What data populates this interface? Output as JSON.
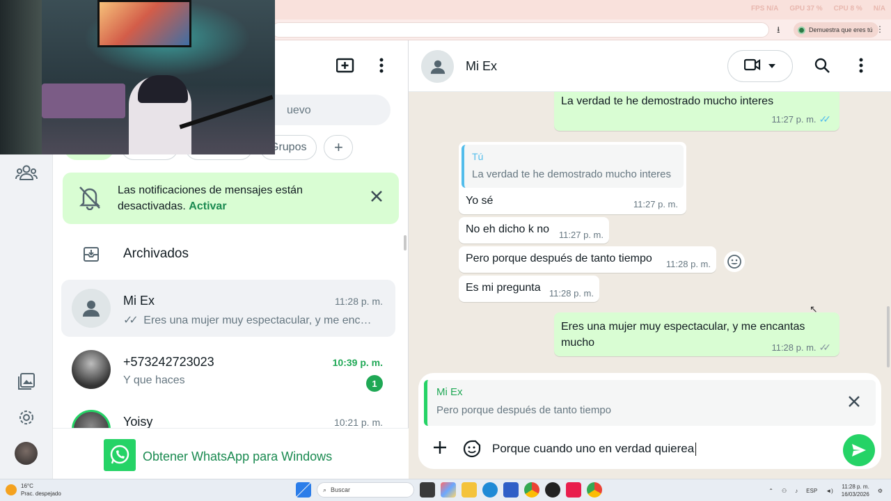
{
  "browser": {
    "stats": [
      "FPS N/A",
      "GPU 37 %",
      "CPU 8 %",
      "N/A"
    ],
    "extension_label": "Demuestra que eres tú"
  },
  "sidebar": {
    "items": [
      "chats-icon",
      "status-icon",
      "channels-icon",
      "communities-icon",
      "media-icon",
      "settings-icon",
      "profile-avatar"
    ]
  },
  "chat_list": {
    "search_placeholder": "uevo",
    "filters": {
      "groups": "Grupos",
      "add": "+"
    },
    "notification": {
      "text": "Las notificaciones de mensajes están desactivadas.",
      "link": "Activar"
    },
    "archived_label": "Archivados",
    "chats": [
      {
        "name": "Mi Ex",
        "time": "11:28 p. m.",
        "preview": "Eres una mujer muy espectacular, y me encan…",
        "ticks": "✓✓",
        "active": true
      },
      {
        "name": "+573242723023",
        "time": "10:39 p. m.",
        "preview": "Y que haces",
        "unread": "1"
      },
      {
        "name": "Yoisy",
        "time": "10:21 p. m."
      }
    ],
    "get_app_label": "Obtener WhatsApp para Windows"
  },
  "conversation": {
    "contact_name": "Mi Ex",
    "messages": [
      {
        "dir": "out",
        "text": "La verdad te he demostrado mucho interes",
        "time": "11:27 p. m.",
        "ticks": "✓✓",
        "read": true
      },
      {
        "dir": "in",
        "quote_author": "Tú",
        "quote_text": "La verdad te he demostrado mucho interes",
        "text": "Yo sé",
        "time": "11:27 p. m."
      },
      {
        "dir": "in",
        "text": "No eh dicho k no",
        "time": "11:27 p. m."
      },
      {
        "dir": "in",
        "text": "Pero porque después de tanto tiempo",
        "time": "11:28 p. m."
      },
      {
        "dir": "in",
        "text": "Es mi pregunta",
        "time": "11:28 p. m."
      },
      {
        "dir": "out",
        "text_line1": "Eres una mujer muy espectacular, y me encantas",
        "text_line2": "mucho",
        "time": "11:28 p. m.",
        "ticks": "✓✓",
        "read": false
      }
    ],
    "reply": {
      "author": "Mi Ex",
      "text": "Pero porque después de tanto tiempo"
    },
    "composer_text": "Porque cuando uno en verdad quierea"
  },
  "taskbar": {
    "weather_temp": "16°C",
    "weather_desc": "Prac. despejado",
    "search_label": "Buscar",
    "lang": "ESP",
    "time": "11:28 p. m.",
    "date": "16/03/2026"
  },
  "colors": {
    "accent": "#25d366",
    "outgoing_bubble": "#d9fdd3",
    "read_ticks": "#53bdeb",
    "chat_bg": "#efeae2"
  }
}
